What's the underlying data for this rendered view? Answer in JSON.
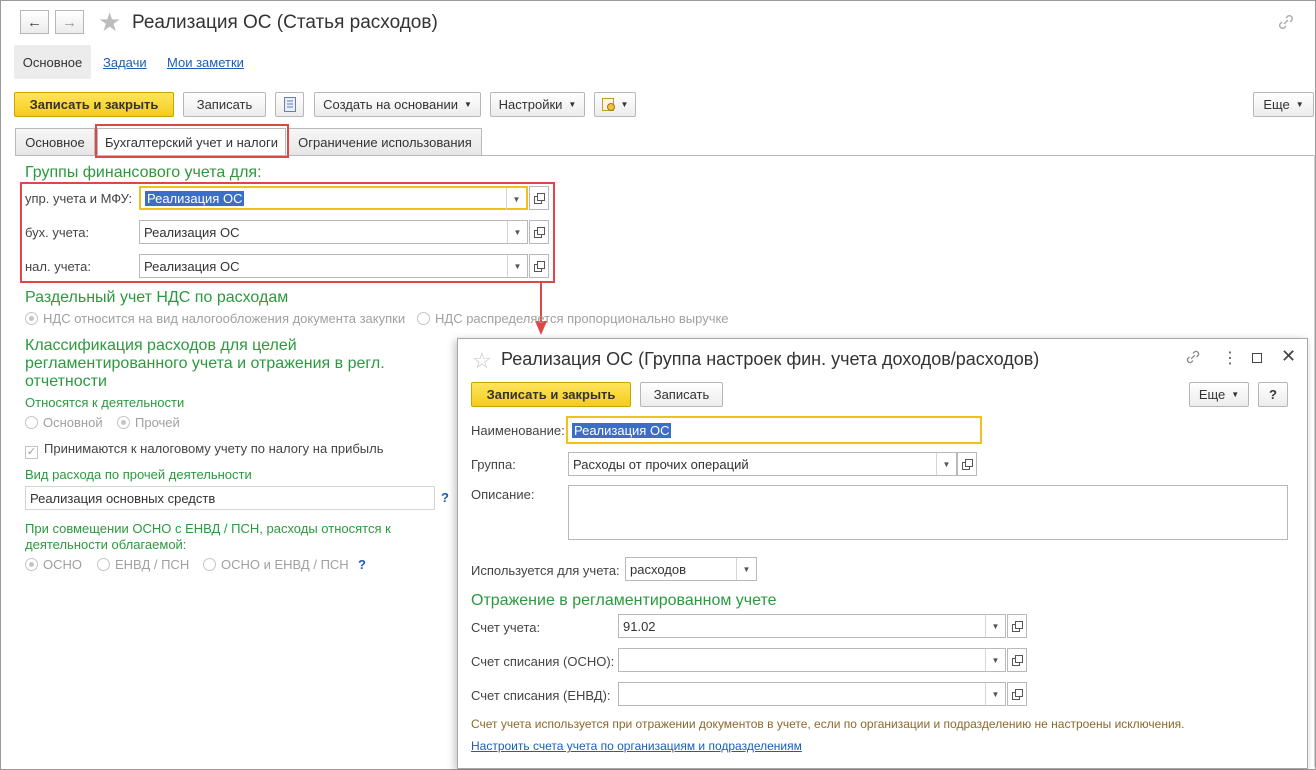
{
  "main": {
    "title": "Реализация ОС (Статья расходов)",
    "nav_tabs": [
      "Основное",
      "Задачи",
      "Мои заметки"
    ],
    "toolbar": {
      "save_close": "Записать и закрыть",
      "save": "Записать",
      "create_based": "Создать на основании",
      "settings": "Настройки",
      "more": "Еще"
    },
    "tabs": [
      "Основное",
      "Бухгалтерский учет и налоги",
      "Ограничение использования"
    ],
    "fin_groups": {
      "heading": "Группы финансового учета для:",
      "rows": [
        {
          "label": "упр. учета и МФУ:",
          "value": "Реализация ОС"
        },
        {
          "label": "бух. учета:",
          "value": "Реализация ОС"
        },
        {
          "label": "нал. учета:",
          "value": "Реализация ОС"
        }
      ]
    },
    "vat": {
      "heading": "Раздельный учет НДС по расходам",
      "option1": "НДС относится на вид налогообложения документа закупки",
      "option2": "НДС распределяется пропорционально выручке"
    },
    "classification": {
      "heading_line1": "Классификация расходов для целей",
      "heading_line2": "регламентированного учета и отражения в регл.",
      "heading_line3": "отчетности",
      "activity_label": "Относятся к деятельности",
      "activity_opt1": "Основной",
      "activity_opt2": "Прочей",
      "tax_checkbox": "Принимаются к налоговому учету по налогу на прибыль",
      "expense_type_label": "Вид расхода по прочей деятельности",
      "expense_type_value": "Реализация основных средств",
      "combo_label_line1": "При совмещении ОСНО с ЕНВД / ПСН, расходы относятся к",
      "combo_label_line2": "деятельности облагаемой:",
      "combo_opt1": "ОСНО",
      "combo_opt2": "ЕНВД / ПСН",
      "combo_opt3": "ОСНО и ЕНВД / ПСН",
      "help": "?"
    }
  },
  "dialog": {
    "title": "Реализация ОС (Группа настроек фин. учета доходов/расходов)",
    "save_close": "Записать и закрыть",
    "save": "Записать",
    "more": "Еще",
    "help": "?",
    "name_label": "Наименование:",
    "name_value": "Реализация ОС",
    "group_label": "Группа:",
    "group_value": "Расходы от прочих операций",
    "description_label": "Описание:",
    "used_for_label": "Используется для учета:",
    "used_for_value": "расходов",
    "reg_heading": "Отражение в регламентированном учете",
    "account_label": "Счет учета:",
    "account_value": "91.02",
    "writeoff_osno_label": "Счет списания (ОСНО):",
    "writeoff_envd_label": "Счет списания (ЕНВД):",
    "note": "Счет учета используется при отражении документов в учете, если по организации и подразделению не настроены исключения.",
    "link": "Настроить счета учета по организациям и подразделениям"
  }
}
